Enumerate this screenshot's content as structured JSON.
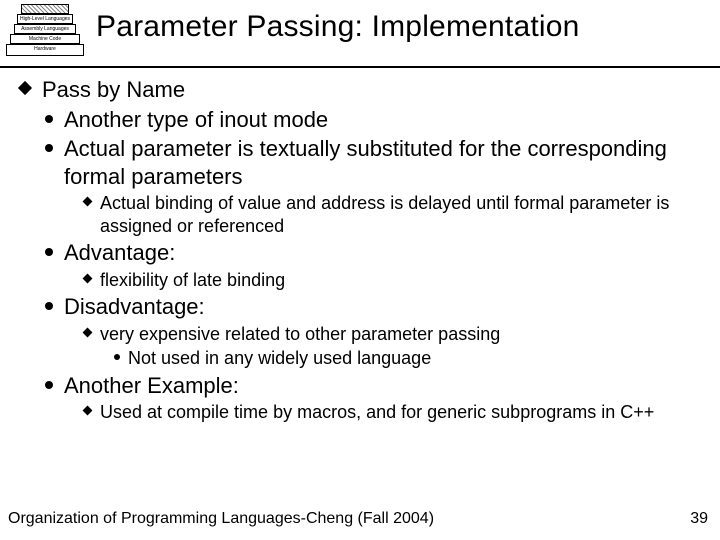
{
  "title": "Parameter Passing: Implementation",
  "icon_layers": [
    "",
    "High-Level Languages",
    "Assembly Languages",
    "Machine Code",
    "Hardware"
  ],
  "heading": "Pass by Name",
  "b1": "Another type of  inout mode",
  "b2": "Actual parameter is textually substituted for the corresponding formal parameters",
  "b2_sub": "Actual binding of value and address is delayed until formal parameter is assigned or referenced",
  "b3": "Advantage:",
  "b3_sub": "flexibility of late binding",
  "b4": "Disadvantage:",
  "b4_sub": "very expensive related to other parameter passing",
  "b4_sub_sub": "Not used in any widely used language",
  "b5": "Another Example:",
  "b5_sub": "Used at compile time by macros, and for generic subprograms in C++",
  "footer_text": "Organization of Programming Languages-Cheng (Fall 2004)",
  "page_number": "39"
}
